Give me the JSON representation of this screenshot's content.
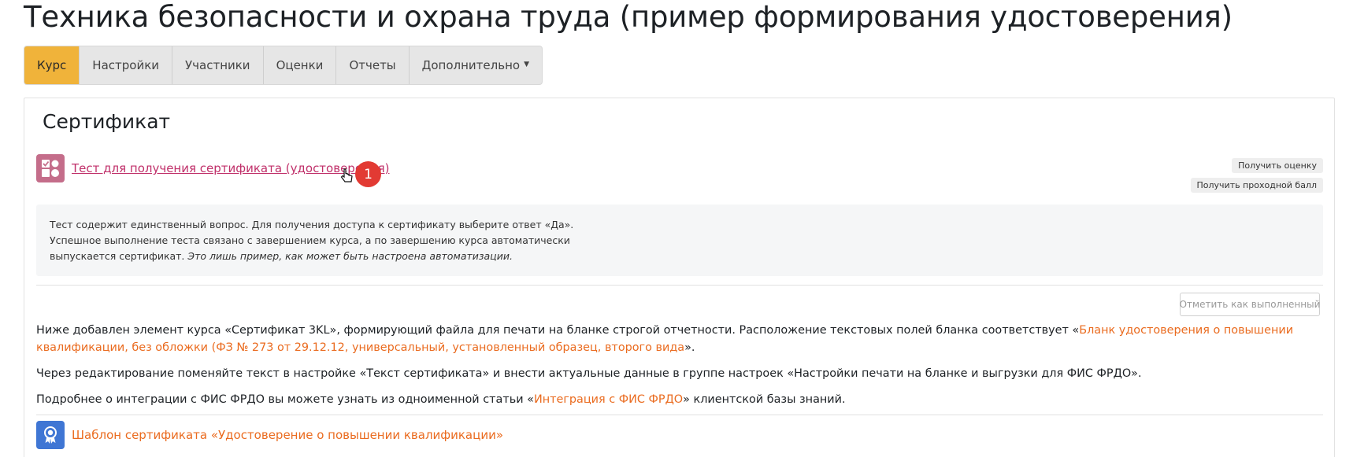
{
  "page": {
    "title": "Техника безопасности и охрана труда (пример формирования удостоверения)"
  },
  "tabs": [
    {
      "label": "Курс",
      "active": true
    },
    {
      "label": "Настройки"
    },
    {
      "label": "Участники"
    },
    {
      "label": "Оценки"
    },
    {
      "label": "Отчеты"
    },
    {
      "label": "Дополнительно"
    }
  ],
  "section": {
    "title": "Сертификат"
  },
  "activity": {
    "link": "Тест для получения сертификата (удостоверения)",
    "badge": "1",
    "pill_grade": "Получить оценку",
    "pill_pass": "Получить проходной балл",
    "desc_line1": "Тест содержит единственный вопрос. Для получения доступа к сертификату выберите ответ «Да».",
    "desc_line2": "Успешное выполнение теста связано с завершением курса, а по завершению курса автоматически",
    "desc_line3_plain": "выпускается сертификат. ",
    "desc_line3_italic": "Это лишь пример, как может быть настроена автоматизации."
  },
  "mark_done": "Отметить как выполненный",
  "content": {
    "p1_a": "Ниже добавлен элемент курса «Сертификат 3KL», формирующий файла для печати на бланке строгой отчетности. Расположение текстовых полей бланка соответствует  «",
    "p1_link": "Бланк удостоверения о повышении квалификации, без обложки (ФЗ № 273 от 29.12.12, универсальный, установленный образец, второго вида",
    "p1_b": "».",
    "p2": "Через редактирование поменяйте текст в настройке «Текст сертификата» и внести актуальные данные в группе настроек «Настройки печати на бланке и выгрузки для ФИС ФРДО».",
    "p3_a": "Подробнее о интеграции с ФИС ФРДО вы можете узнать из одноименной статьи «",
    "p3_link": "Интеграция с ФИС ФРДО",
    "p3_b": "» клиентской базы знаний."
  },
  "certificate": {
    "link": "Шаблон сертификата «Удостоверение о повышении квалификации»"
  },
  "colors": {
    "accent": "#f0b33a",
    "link_orange": "#ea6b1f",
    "quiz_icon": "#c46d8a",
    "cert_icon": "#3f76d4",
    "badge": "#e23a33"
  },
  "icons": {
    "quiz": "quiz-icon",
    "cursor": "hand-cursor-icon",
    "certificate": "certificate-icon",
    "chevron": "chevron-down-icon"
  }
}
